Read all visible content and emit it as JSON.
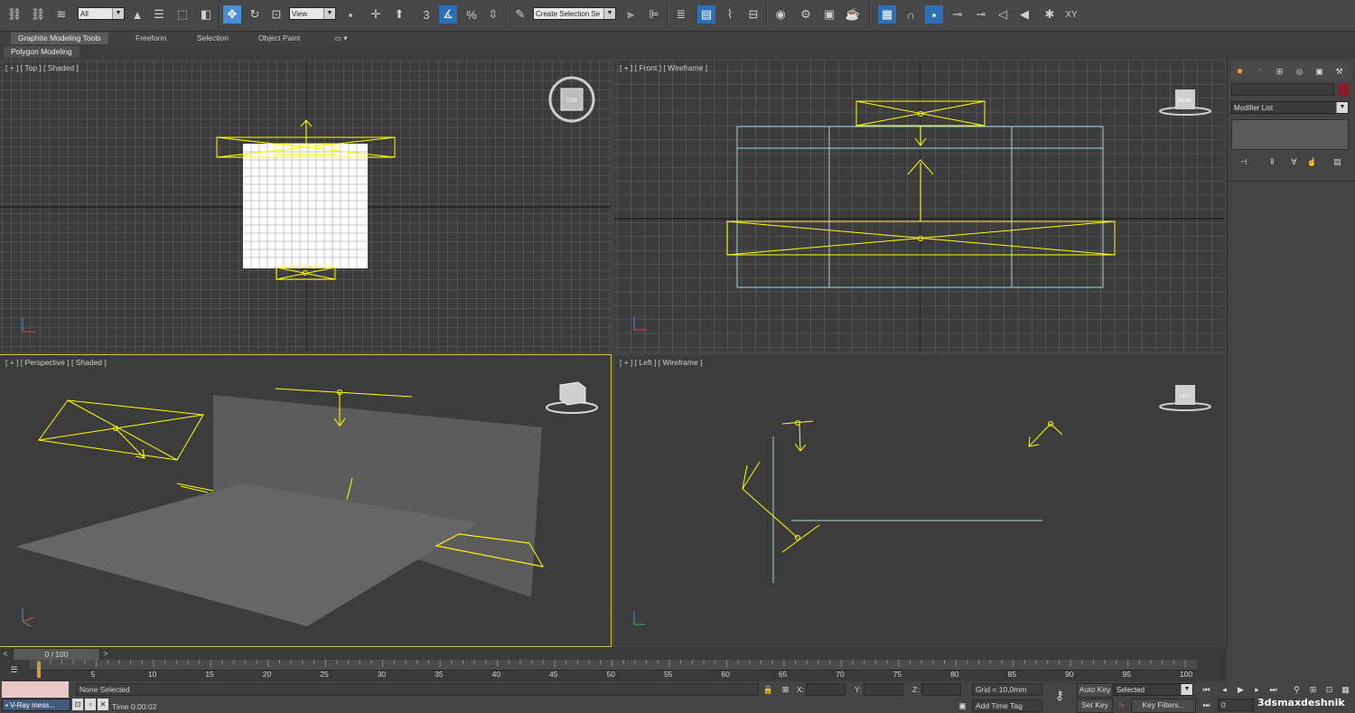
{
  "toolbar": {
    "selection_filter": "All",
    "ref_coord": "View",
    "named_selection_placeholder": "Create Selection Se",
    "snaps_label": "3",
    "percent_label": "%",
    "xy_label": "XY"
  },
  "ribbon": {
    "tabs": [
      "Graphite Modeling Tools",
      "Freeform",
      "Selection",
      "Object Paint"
    ],
    "subtab": "Polygon Modeling"
  },
  "viewports": {
    "top": {
      "label": "[ + ] [ Top ] [ Shaded ]",
      "cube": "TOP"
    },
    "front": {
      "label": "[ + ] [ Front ] [ Wireframe ]",
      "cube": "FRONT"
    },
    "perspective": {
      "label": "[ + ] [ Perspective ] [ Shaded ]"
    },
    "left": {
      "label": "[ + ] [ Left ] [ Wireframe ]",
      "cube": "LEFT"
    }
  },
  "command_panel": {
    "modifier_list": "Modifier List",
    "color": "#8b1a2e"
  },
  "timeline": {
    "frame": "0 / 100",
    "ticks": [
      "5",
      "10",
      "15",
      "20",
      "25",
      "30",
      "35",
      "40",
      "45",
      "50",
      "55",
      "60",
      "65",
      "70",
      "75",
      "80",
      "85",
      "90",
      "95",
      "100"
    ]
  },
  "status": {
    "selection": "None Selected",
    "x_label": "X:",
    "y_label": "Y:",
    "z_label": "Z:",
    "grid": "Grid = 10,0mm",
    "time_prefix": "Time",
    "time_value": "0:00:02",
    "add_time_tag": "Add Time Tag",
    "auto_key": "Auto Key",
    "set_key": "Set Key",
    "key_mode": "Selected",
    "key_filters": "Key Filters...",
    "current_frame": "0",
    "vray_task": "V-Ray mess...",
    "watermark": "3dsmaxdeshnik"
  },
  "colors": {
    "selected": "#ffff00",
    "grid": "#8a8a8a",
    "active_blue": "#4a8fd6",
    "viewport_bg": "#3c3c3c",
    "light_lines": "#9fd8d8"
  }
}
